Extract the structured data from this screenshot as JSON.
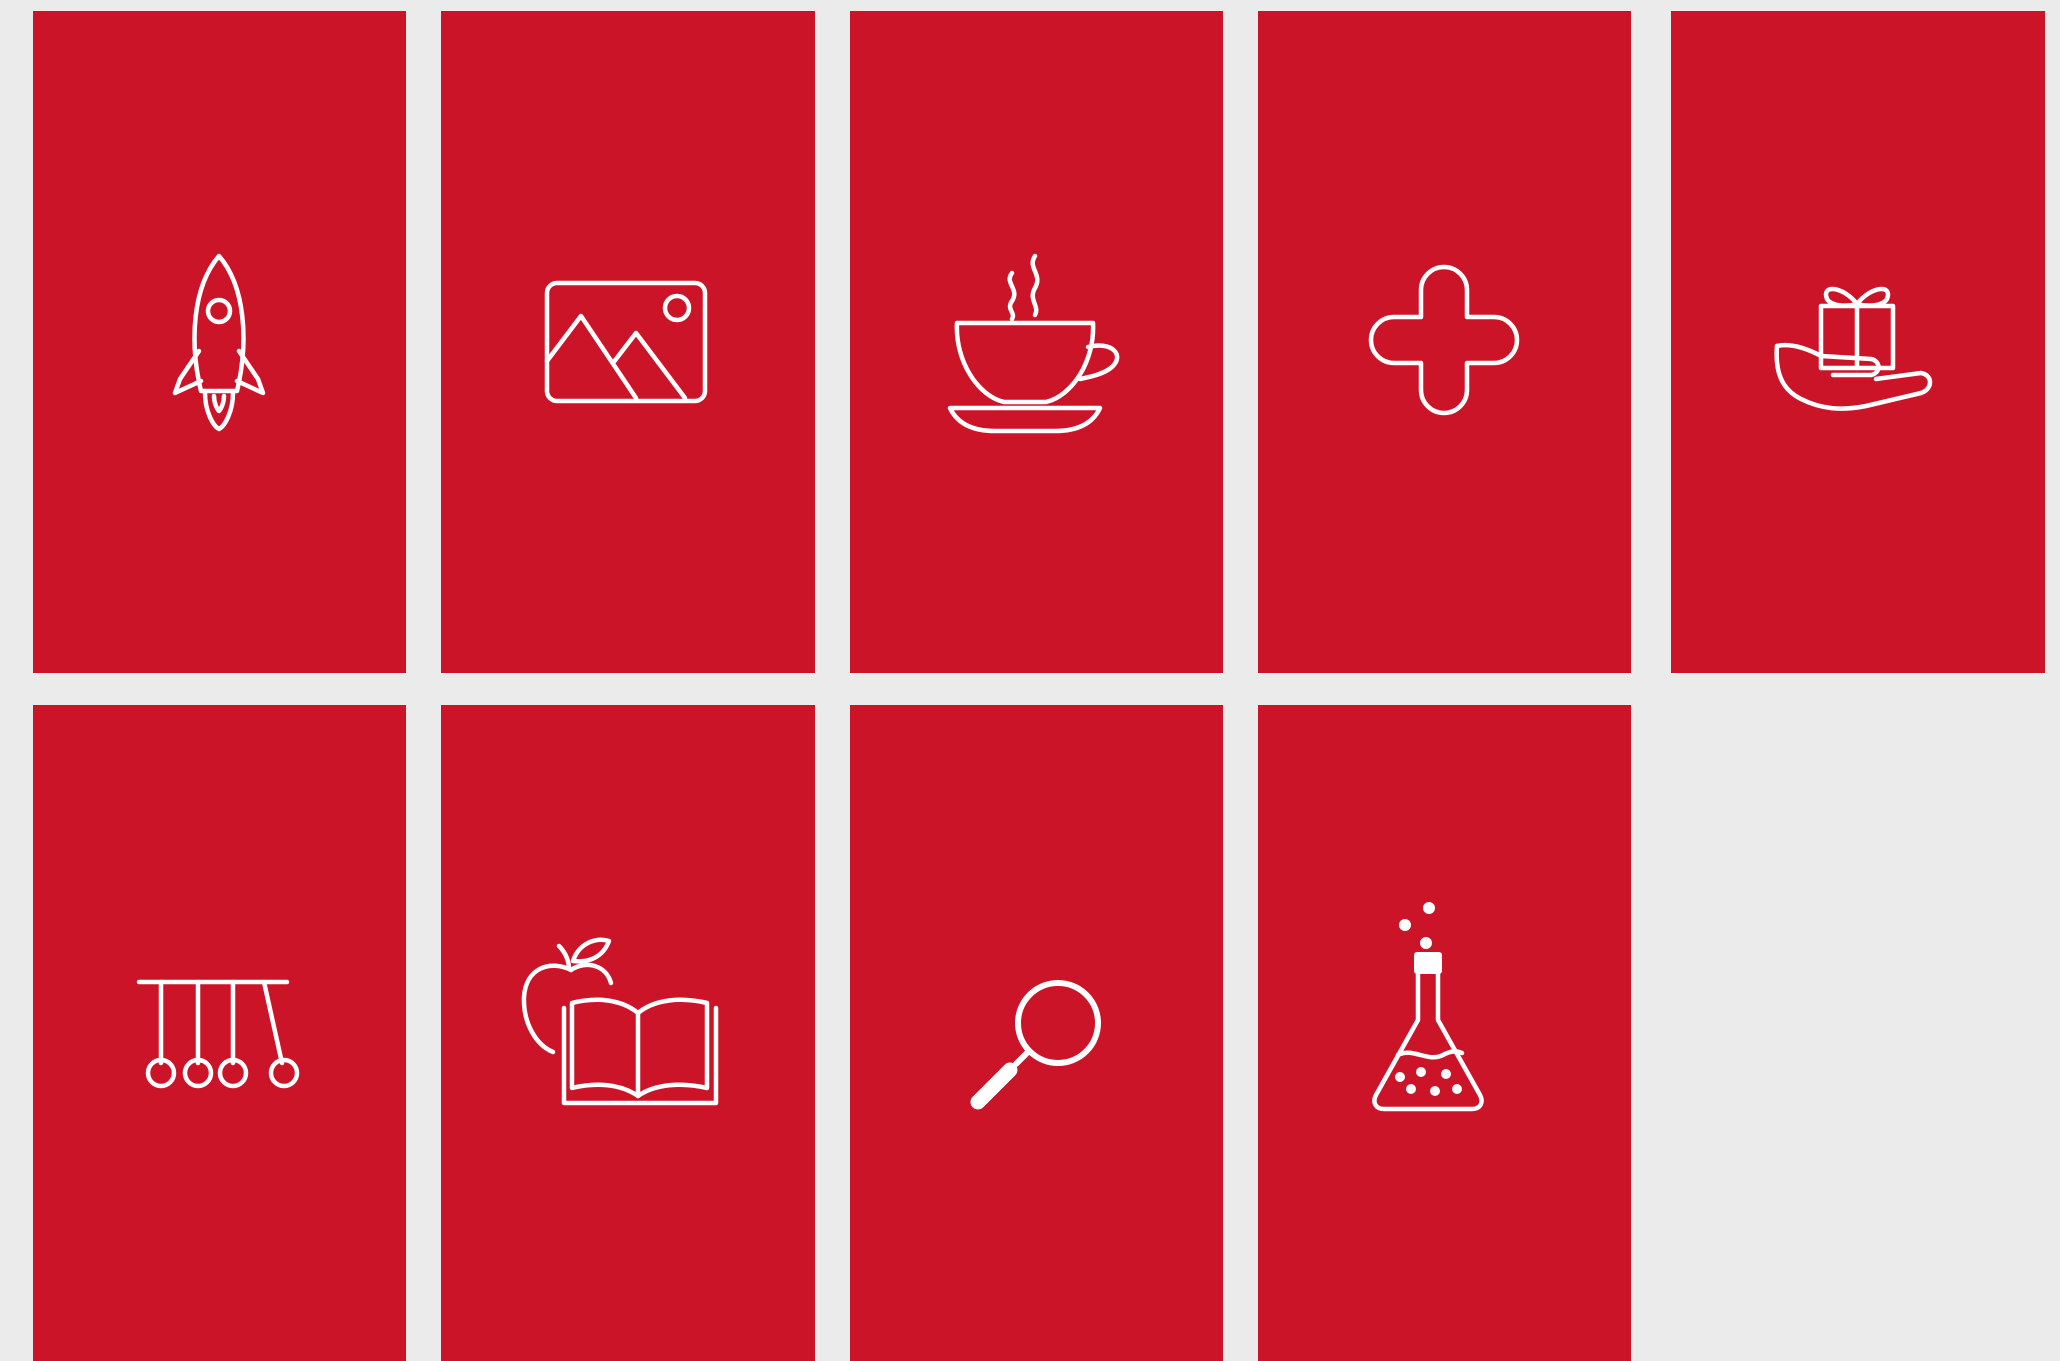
{
  "colors": {
    "background": "#ebebeb",
    "tile": "#cc1429",
    "icon": "#ffffff"
  },
  "tiles": [
    {
      "icon": "rocket-icon"
    },
    {
      "icon": "image-icon"
    },
    {
      "icon": "coffee-cup-icon"
    },
    {
      "icon": "medical-cross-icon"
    },
    {
      "icon": "gift-in-hand-icon"
    },
    {
      "icon": "newtons-cradle-icon"
    },
    {
      "icon": "book-and-apple-icon"
    },
    {
      "icon": "magnifying-glass-icon"
    },
    {
      "icon": "lab-flask-icon"
    }
  ]
}
